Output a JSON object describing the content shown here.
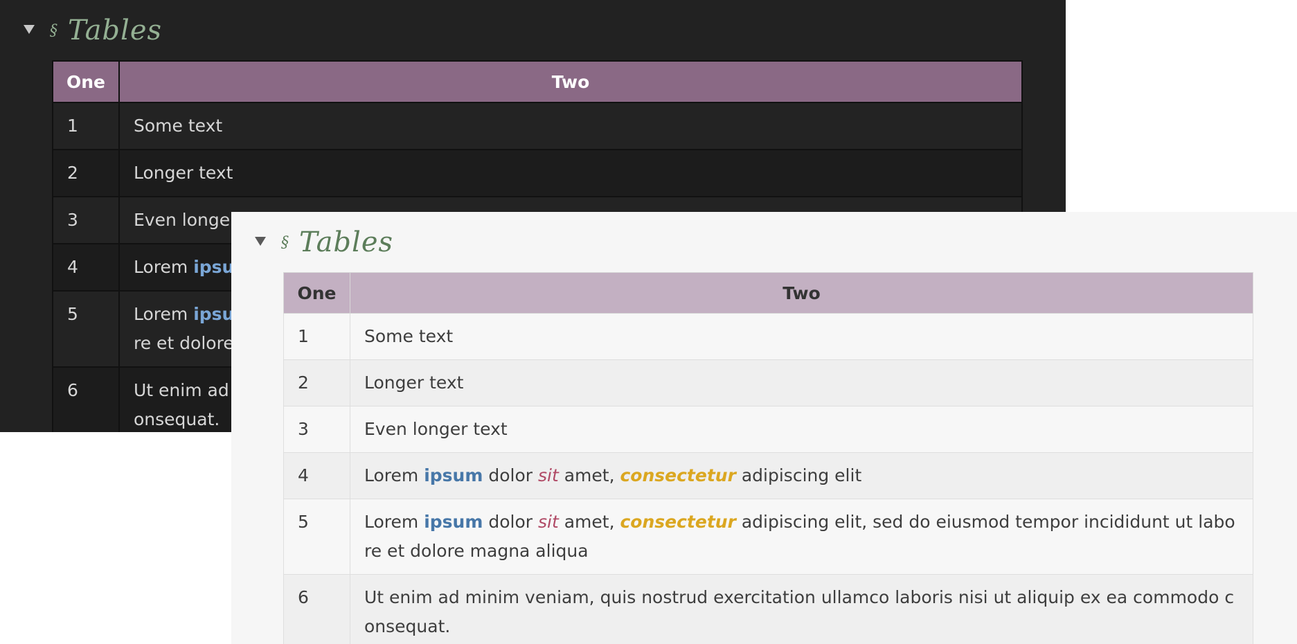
{
  "heading": {
    "section_icon": "§",
    "title": "Tables"
  },
  "table": {
    "headers": [
      "One",
      "Two"
    ],
    "rows": [
      {
        "num": "1",
        "text": "Some text"
      },
      {
        "num": "2",
        "text": "Longer text"
      },
      {
        "num": "3",
        "text": "Even longer text"
      },
      {
        "num": "4",
        "lead": "Lorem ",
        "bold": "ipsum",
        "mid1": " dolor ",
        "em": "sit",
        "mid2": " amet, ",
        "strong_em": "consectetur",
        "tail": " adipiscing elit"
      },
      {
        "num": "5",
        "lead": "Lorem ",
        "bold": "ipsum",
        "mid1": " dolor ",
        "em": "sit",
        "mid2": " amet, ",
        "strong_em": "consectetur",
        "tail": " adipiscing elit, sed do eiusmod tempor incididunt ut labore et dolore magna aliqua"
      },
      {
        "num": "6",
        "text": "Ut enim ad minim veniam, quis nostrud exercitation ullamco laboris nisi ut aliquip ex ea commodo consequat."
      }
    ]
  },
  "colors": {
    "dark_header": "#8a6985",
    "light_header": "#c3b0c2",
    "title_green_dark": "#94b093",
    "title_green_light": "#5c7d5a",
    "link_blue": "#4777a8",
    "em_red": "#b04a66",
    "accent_gold": "#dba721"
  }
}
